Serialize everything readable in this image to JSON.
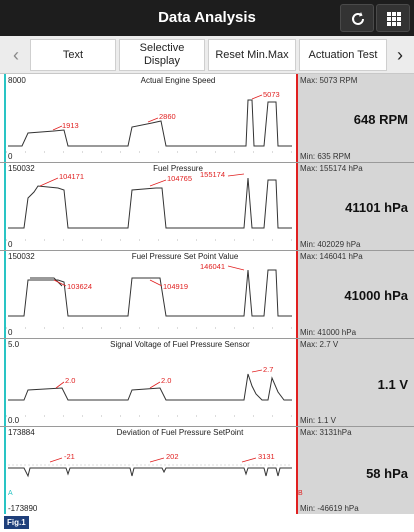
{
  "header": {
    "title": "Data Analysis"
  },
  "toolbar": {
    "buttons": [
      "Text",
      "Selective\nDisplay",
      "Reset Min.Max",
      "Actuation Test"
    ]
  },
  "cursors": {
    "a": "A",
    "b": "B"
  },
  "figure_label": "Fig.1",
  "colors": {
    "cursor_a": "#29c4c4",
    "cursor_b": "#e02020",
    "header": "#1d1d1d",
    "side_panel": "#d6d6d6"
  },
  "panels": [
    {
      "title": "Actual Engine Speed",
      "y_top": "8000",
      "y_bottom": "0",
      "max": "Max: 5073 RPM",
      "value": "648 RPM",
      "min": "Min: 635 RPM",
      "markers": [
        "1913",
        "2860",
        "5073"
      ]
    },
    {
      "title": "Fuel Pressure",
      "y_top": "150032",
      "y_bottom": "0",
      "max": "Max: 155174 hPa",
      "value": "41101 hPa",
      "min": "Min: 402029 hPa",
      "markers": [
        "104171",
        "104765",
        "155174"
      ]
    },
    {
      "title": "Fuel Pressure Set Point Value",
      "y_top": "150032",
      "y_bottom": "0",
      "max": "Max: 146041 hPa",
      "value": "41000 hPa",
      "min": "Min: 41000 hPa",
      "markers": [
        "103624",
        "104919",
        "146041"
      ]
    },
    {
      "title": "Signal Voltage of Fuel Pressure Sensor",
      "y_top": "5.0",
      "y_bottom": "0.0",
      "max": "Max: 2.7 V",
      "value": "1.1 V",
      "min": "Min: 1.1 V",
      "markers": [
        "2.0",
        "2.0",
        "2.7"
      ]
    },
    {
      "title": "Deviation of Fuel Pressure SetPoint",
      "y_top": "173884",
      "y_bottom": "-173890",
      "max": "Max: 3131hPa",
      "value": "58 hPa",
      "min": "Min: -46619 hPa",
      "markers": [
        "-21",
        "202",
        "3131"
      ]
    }
  ]
}
